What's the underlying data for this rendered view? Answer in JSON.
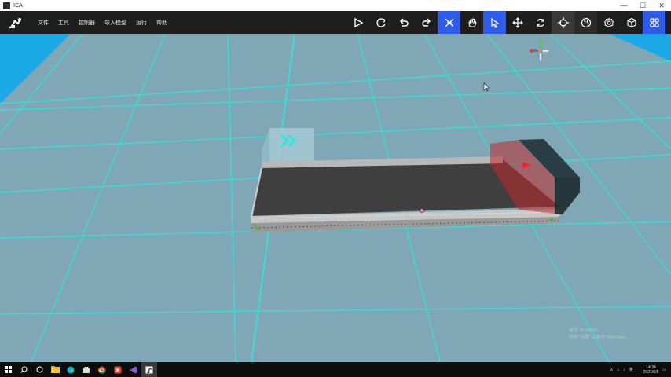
{
  "window": {
    "title": "ICA",
    "minimize": "—",
    "maximize": "☐",
    "close": "✕"
  },
  "menu": {
    "items": [
      "文件",
      "工具",
      "控制器",
      "导入模型",
      "运行",
      "帮助"
    ]
  },
  "toolbar": {
    "tools": [
      {
        "name": "play-icon",
        "state": "normal"
      },
      {
        "name": "refresh-icon",
        "state": "normal"
      },
      {
        "name": "undo-icon",
        "state": "normal"
      },
      {
        "name": "redo-icon",
        "state": "normal"
      },
      {
        "name": "snap-icon",
        "state": "active"
      },
      {
        "name": "hand-icon",
        "state": "normal"
      },
      {
        "name": "select-cursor-icon",
        "state": "active"
      },
      {
        "name": "move-icon",
        "state": "normal"
      },
      {
        "name": "rotate-icon",
        "state": "normal"
      },
      {
        "name": "crosshair-icon",
        "state": "hover"
      },
      {
        "name": "globe-icon",
        "state": "dark"
      },
      {
        "name": "settings-icon",
        "state": "normal"
      },
      {
        "name": "cube-icon",
        "state": "normal"
      },
      {
        "name": "grid-icon",
        "state": "active"
      }
    ]
  },
  "colors": {
    "accent": "#2f5bea",
    "grid": "#2ee6e0",
    "floor": "#7fa7b5",
    "sky": "#1aa9e6"
  },
  "watermark": {
    "line1": "激活 Windows",
    "line2": "转到\"设置\"以激活 Windows。"
  },
  "taskbar": {
    "apps": [
      "windows-start-icon",
      "search-icon",
      "task-view-icon",
      "file-explorer-icon",
      "edge-icon",
      "store-icon",
      "chrome-icon",
      "media-icon",
      "visual-studio-icon",
      "ica-app-icon"
    ],
    "tray_text": "英",
    "time": "14:34",
    "date": "2021/6/8"
  }
}
